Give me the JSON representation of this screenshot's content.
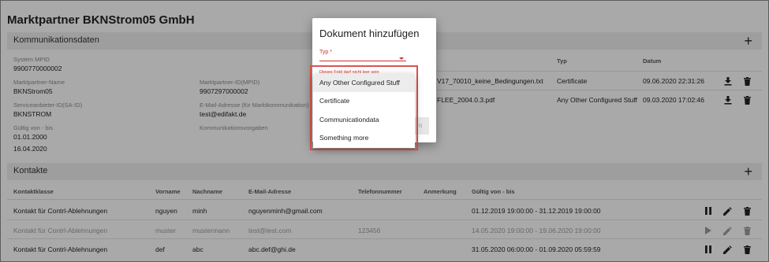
{
  "page": {
    "title": "Marktpartner BKNStrom05 GmbH"
  },
  "kommunikation": {
    "title": "Kommunikationsdaten",
    "add_icon": "plus-icon",
    "fields": {
      "system_mpid": {
        "label": "System MPID",
        "value": "9900770000002"
      },
      "marktpartner_name": {
        "label": "Marktpartner-Name",
        "value": "BKNStrom05"
      },
      "marktpartner_id": {
        "label": "Marktpartner-ID(MPID)",
        "value": "9907297000002"
      },
      "service_id": {
        "label": "Serviceanbieter-ID(SA-ID)",
        "value": "BKNSTROM"
      },
      "email": {
        "label": "E-Mail-Adresse (für Marktkommunikation)",
        "value": "test@edifakt.de"
      },
      "gueltig": {
        "label": "Gültig von - bis",
        "value_from": "01.01.2000",
        "value_to": "16.04.2020"
      },
      "kommunikationsvorgaben": {
        "label": "Kommunikationsvorgaben"
      }
    },
    "docs": {
      "headers": {
        "typ": "Typ",
        "datum": "Datum"
      },
      "rows": [
        {
          "name": "V17_70010_keine_Bedingungen.txt",
          "typ": "Certificate",
          "datum": "09.06.2020 22:31:26"
        },
        {
          "name": "FLEE_2004.0.3.pdf",
          "typ": "Any Other Configured Stuff",
          "datum": "09.03.2020 17:02:46"
        }
      ]
    }
  },
  "kontakte": {
    "title": "Kontakte",
    "add_icon": "plus-icon",
    "headers": {
      "klasse": "Kontaktklasse",
      "vorname": "Vorname",
      "nachname": "Nachname",
      "email": "E-Mail-Adresse",
      "telefon": "Telefonnummer",
      "anmerkung": "Anmerkung",
      "gueltig": "Gültig von - bis"
    },
    "rows": [
      {
        "klasse": "Kontakt für Contrl-Ablehnungen",
        "vorname": "nguyen",
        "nachname": "minh",
        "email": "nguyenminh@gmail.com",
        "telefon": "",
        "anmerkung": "",
        "gueltig": "01.12.2019 19:00:00 - 31.12.2019 19:00:00",
        "muted": false
      },
      {
        "klasse": "Kontakt für Contrl-Ablehnungen",
        "vorname": "muster",
        "nachname": "mustermann",
        "email": "test@test.com",
        "telefon": "123456",
        "anmerkung": "",
        "gueltig": "14.05.2020 19:00:00 - 19.06.2020 19:00:00",
        "muted": true
      },
      {
        "klasse": "Kontakt für Contrl-Ablehnungen",
        "vorname": "def",
        "nachname": "abc",
        "email": "abc.def@ghi.de",
        "telefon": "",
        "anmerkung": "",
        "gueltig": "31.05.2020 06:00:00 - 01.09.2020 05:59:59",
        "muted": false
      }
    ]
  },
  "dialog": {
    "title": "Dokument hinzufügen",
    "typ_label": "Typ *",
    "error_text": "Dieses Feld darf nicht leer sein",
    "button_label": "N",
    "options": [
      "Any Other Configured Stuff",
      "Certificate",
      "Communicationdata",
      "Something more"
    ],
    "highlighted_option": "Any Other Configured Stuff",
    "error_color": "#d32f2f"
  }
}
